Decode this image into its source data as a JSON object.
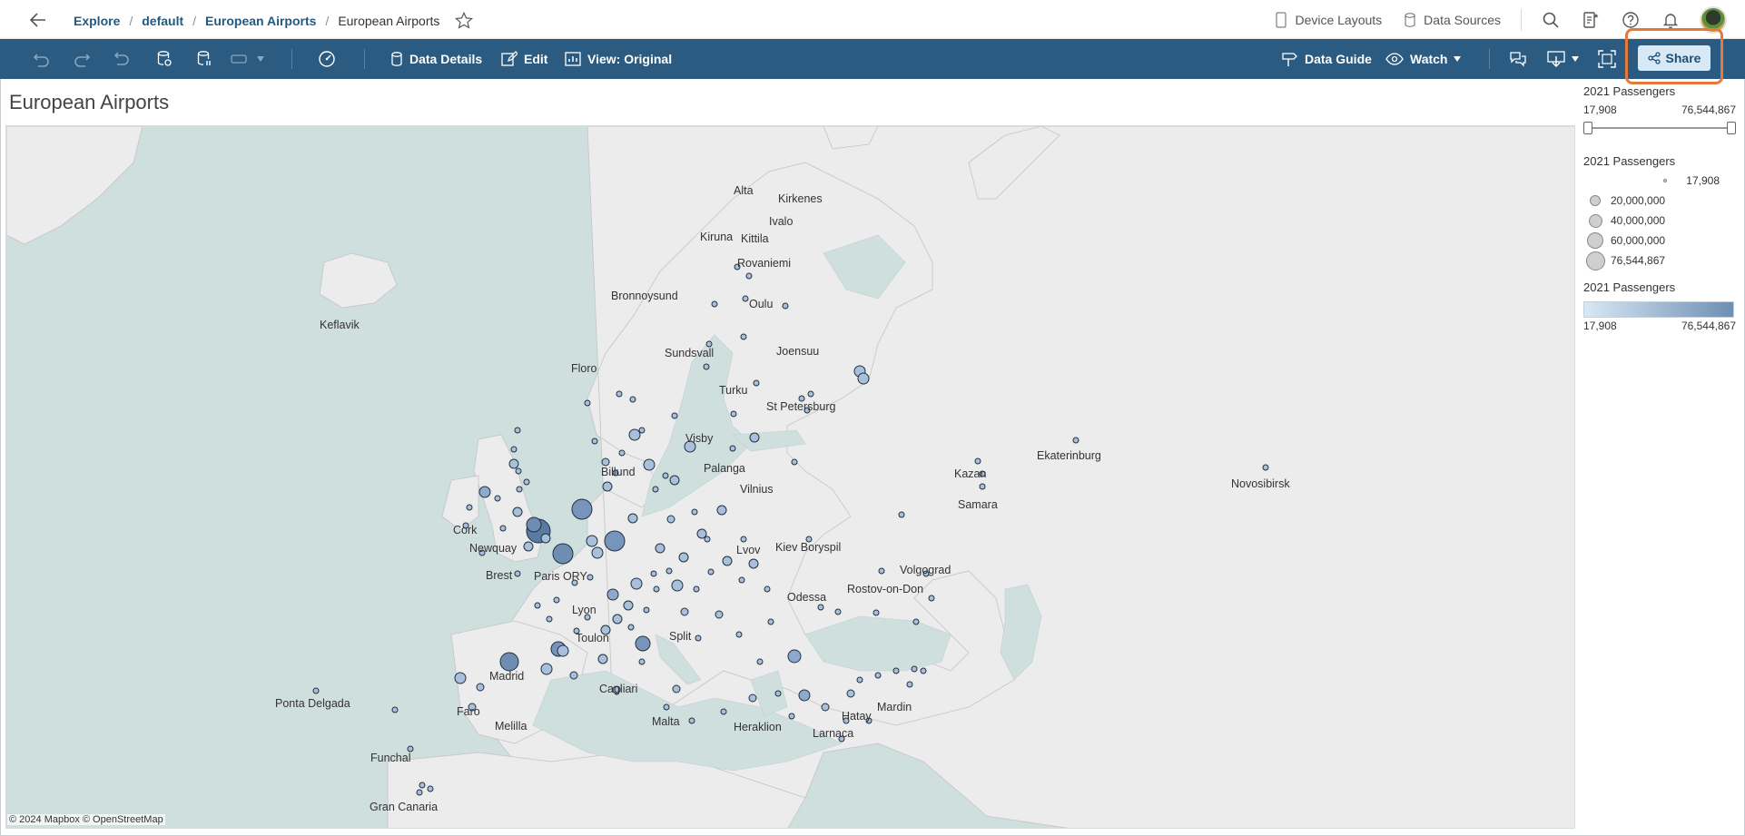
{
  "breadcrumb": {
    "explore": "Explore",
    "project": "default",
    "workbook": "European Airports",
    "view": "European Airports"
  },
  "nav": {
    "device_layouts": "Device Layouts",
    "data_sources": "Data Sources"
  },
  "toolbar": {
    "data_details": "Data Details",
    "edit": "Edit",
    "view_original": "View: Original",
    "data_guide": "Data Guide",
    "watch": "Watch",
    "share": "Share"
  },
  "view": {
    "title": "European Airports"
  },
  "legends": {
    "range": {
      "title": "2021 Passengers",
      "min": "17,908",
      "max": "76,544,867"
    },
    "size": {
      "title": "2021 Passengers",
      "items": [
        "17,908",
        "20,000,000",
        "40,000,000",
        "60,000,000",
        "76,544,867"
      ]
    },
    "color": {
      "title": "2021 Passengers",
      "min": "17,908",
      "max": "76,544,867"
    }
  },
  "map": {
    "attribution": "© 2024 Mapbox © OpenStreetMap",
    "labels": [
      {
        "text": "Alta"
      },
      {
        "text": "Kirkenes"
      },
      {
        "text": "Ivalo"
      },
      {
        "text": "Kiruna"
      },
      {
        "text": "Kittila"
      },
      {
        "text": "Rovaniemi"
      },
      {
        "text": "Bronnoysund"
      },
      {
        "text": "Oulu"
      },
      {
        "text": "Keflavik"
      },
      {
        "text": "Joensuu"
      },
      {
        "text": "Sundsvall"
      },
      {
        "text": "Floro"
      },
      {
        "text": "Turku"
      },
      {
        "text": "St Petersburg"
      },
      {
        "text": "Visby"
      },
      {
        "text": "Palanga"
      },
      {
        "text": "Billund"
      },
      {
        "text": "Vilnius"
      },
      {
        "text": "Kazan"
      },
      {
        "text": "Ekaterinburg"
      },
      {
        "text": "Novosibirsk"
      },
      {
        "text": "Samara"
      },
      {
        "text": "Cork"
      },
      {
        "text": "Newquay"
      },
      {
        "text": "Lvov"
      },
      {
        "text": "Kiev Boryspil"
      },
      {
        "text": "Volgograd"
      },
      {
        "text": "Brest"
      },
      {
        "text": "Paris ORY"
      },
      {
        "text": "Rostov-on-Don"
      },
      {
        "text": "Odessa"
      },
      {
        "text": "Lyon"
      },
      {
        "text": "Toulon"
      },
      {
        "text": "Split"
      },
      {
        "text": "Madrid"
      },
      {
        "text": "Cagliari"
      },
      {
        "text": "Ponta Delgada"
      },
      {
        "text": "Faro"
      },
      {
        "text": "Hatay"
      },
      {
        "text": "Mardin"
      },
      {
        "text": "Melilla"
      },
      {
        "text": "Malta"
      },
      {
        "text": "Heraklion"
      },
      {
        "text": "Larnaca"
      },
      {
        "text": "Funchal"
      },
      {
        "text": "Gran Canaria"
      }
    ]
  }
}
